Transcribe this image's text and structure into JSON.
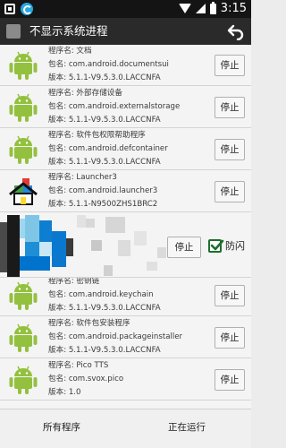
{
  "status_bar": {
    "time": "3:15"
  },
  "toolbar": {
    "title": "不显示系统进程"
  },
  "stop_label": "停止",
  "processes": [
    {
      "name": "程序名: 文档",
      "package": "包名: com.android.documentsui",
      "version": "版本: 5.1.1-V9.5.3.0.LACCNFA",
      "icon": "android-robot-icon"
    },
    {
      "name": "程序名: 外部存储设备",
      "package": "包名: com.android.externalstorage",
      "version": "版本: 5.1.1-V9.5.3.0.LACCNFA",
      "icon": "android-robot-icon"
    },
    {
      "name": "程序名: 软件包权限帮助程序",
      "package": "包名: com.android.defcontainer",
      "version": "版本: 5.1.1-V9.5.3.0.LACCNFA",
      "icon": "android-robot-icon"
    },
    {
      "name": "程序名: Launcher3",
      "package": "包名: com.android.launcher3",
      "version": "版本: 5.1.1-N9500ZHS1BRC2",
      "icon": "home-icon"
    },
    {
      "name": "程序名: 密钥链",
      "package": "包名: com.android.keychain",
      "version": "版本: 5.1.1-V9.5.3.0.LACCNFA",
      "icon": "android-robot-icon"
    },
    {
      "name": "程序名: 软件包安装程序",
      "package": "包名: com.android.packageinstaller",
      "version": "版本: 5.1.1-V9.5.3.0.LACCNFA",
      "icon": "android-robot-icon"
    },
    {
      "name": "程序名: Pico TTS",
      "package": "包名: com.svox.pico",
      "version": "版本: 1.0",
      "icon": "android-robot-icon"
    }
  ],
  "special_row": {
    "stop_label": "停止",
    "flash_label": "防闪",
    "flash_checked": true
  },
  "tabs": {
    "all": "所有程序",
    "running": "正在运行"
  }
}
